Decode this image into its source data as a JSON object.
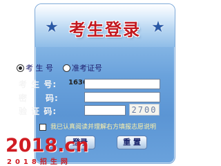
{
  "title": "考生登录",
  "login_type": {
    "options": [
      {
        "label": "考 生 号",
        "selected": true
      },
      {
        "label": "准考证号",
        "selected": false
      }
    ]
  },
  "fields": {
    "examinee_number": {
      "label": "考 生 号:",
      "prefix": "1636",
      "value": ""
    },
    "password": {
      "label": "密　　码:",
      "value": ""
    },
    "captcha": {
      "label": "验 证 码:",
      "value": "",
      "image_text": "2700"
    }
  },
  "agreement": {
    "label": "我已认真阅读并理解右方填报志愿说明",
    "checked": false
  },
  "buttons": {
    "login": "登录",
    "reset": "重 置"
  },
  "watermark": {
    "logo": "2018.cn",
    "subtitle": "2018招生网"
  },
  "colors": {
    "title": "#c2181f",
    "panel": "#5b95d4",
    "logo": "#d01c22"
  }
}
